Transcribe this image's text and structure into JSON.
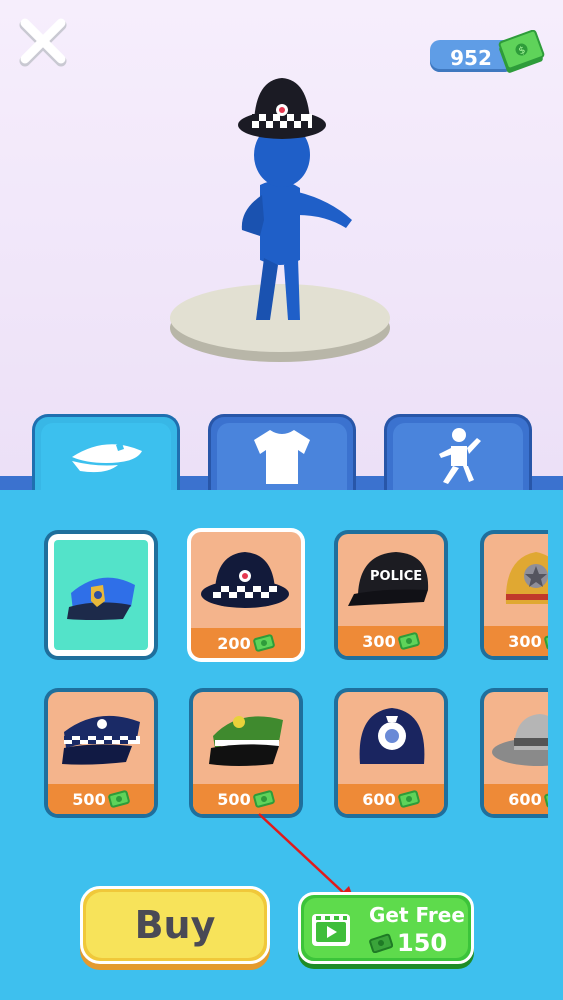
{
  "header": {
    "close_icon": "close-icon",
    "currency": {
      "amount": "952",
      "icon": "cash-stack-icon"
    }
  },
  "tabs": [
    {
      "name": "hats",
      "icon": "police-cap-icon",
      "active": true
    },
    {
      "name": "shirts",
      "icon": "tshirt-icon",
      "active": false
    },
    {
      "name": "dances",
      "icon": "dance-pose-icon",
      "active": false
    }
  ],
  "items": [
    {
      "name": "blue-police-cap",
      "owned": true,
      "selected": false,
      "price": ""
    },
    {
      "name": "checkered-bowler-hat",
      "owned": false,
      "selected": true,
      "price": "200"
    },
    {
      "name": "police-baseball-cap",
      "owned": false,
      "selected": false,
      "price": "300",
      "hat_text": "POLICE"
    },
    {
      "name": "yellow-star-helmet",
      "owned": false,
      "selected": false,
      "price": "300"
    },
    {
      "name": "navy-checkered-cap",
      "owned": false,
      "selected": false,
      "price": "500"
    },
    {
      "name": "green-officer-cap",
      "owned": false,
      "selected": false,
      "price": "500"
    },
    {
      "name": "custodian-helmet",
      "owned": false,
      "selected": false,
      "price": "600"
    },
    {
      "name": "grey-fedora",
      "owned": false,
      "selected": false,
      "price": "600"
    }
  ],
  "actions": {
    "buy_label": "Buy",
    "get_free_label": "Get Free",
    "get_free_amount": "150"
  },
  "colors": {
    "panel": "#3ec0ee",
    "card": "#f4b48c",
    "price_bar": "#ee8a37",
    "buy": "#f7e35a",
    "free": "#5edb4c"
  }
}
